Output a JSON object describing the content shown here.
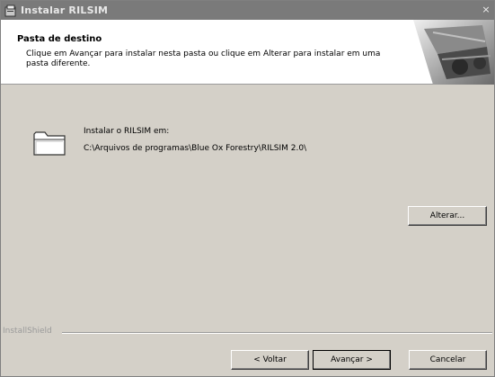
{
  "window": {
    "title": "Instalar RILSIM",
    "close_glyph": "×"
  },
  "header": {
    "title": "Pasta de destino",
    "description": "Clique em Avançar para instalar nesta pasta ou clique em Alterar para instalar em uma pasta diferente."
  },
  "content": {
    "install_label": "Instalar o RILSIM em:",
    "install_path": "C:\\Arquivos de programas\\Blue Ox Forestry\\RILSIM 2.0\\",
    "change_button": "Alterar..."
  },
  "footer": {
    "brand": "InstallShield",
    "back_button": "< Voltar",
    "next_button": "Avançar >",
    "cancel_button": "Cancelar"
  },
  "icons": {
    "app": "installer-icon",
    "folder": "folder-icon",
    "close": "close-icon"
  }
}
